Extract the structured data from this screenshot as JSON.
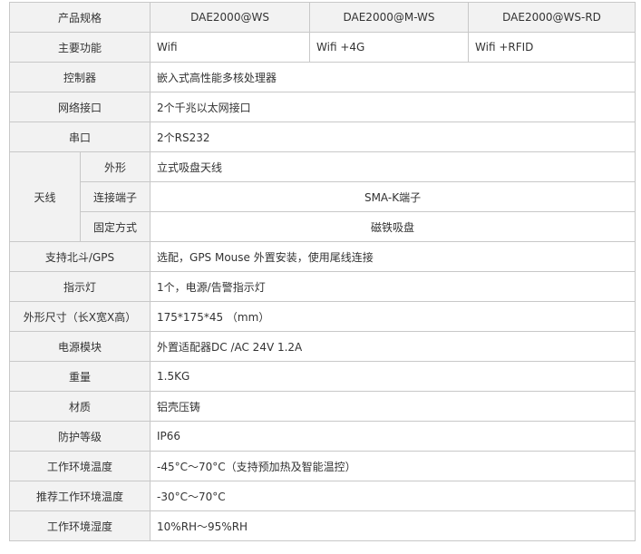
{
  "header": {
    "label": "产品规格",
    "models": [
      "DAE2000@WS",
      "DAE2000@M-WS",
      "DAE2000@WS-RD"
    ]
  },
  "main_function": {
    "label": "主要功能",
    "values": [
      "Wifi",
      "Wifi +4G",
      "Wifi +RFID"
    ]
  },
  "controller": {
    "label": "控制器",
    "value": "嵌入式高性能多核处理器"
  },
  "network": {
    "label": "网络接口",
    "value": "2个千兆以太网接口"
  },
  "serial": {
    "label": "串口",
    "value": "2个RS232"
  },
  "antenna": {
    "label": "天线",
    "shape": {
      "label": "外形",
      "value": "立式吸盘天线"
    },
    "connector": {
      "label": "连接端子",
      "value": "SMA-K端子"
    },
    "mount": {
      "label": "固定方式",
      "value": "磁铁吸盘"
    }
  },
  "beidou_gps": {
    "label": "支持北斗/GPS",
    "value": "选配，GPS Mouse 外置安装，使用尾线连接"
  },
  "indicator": {
    "label": "指示灯",
    "value": "1个，电源/告警指示灯"
  },
  "dimensions": {
    "label": "外形尺寸（长X宽X高）",
    "value": "175*175*45 （mm）"
  },
  "power": {
    "label": "电源模块",
    "value": "外置适配器DC /AC 24V 1.2A"
  },
  "weight": {
    "label": "重量",
    "value": "1.5KG"
  },
  "material": {
    "label": "材质",
    "value": "铝壳压铸"
  },
  "protection": {
    "label": "防护等级",
    "value": "IP66"
  },
  "operating_temp": {
    "label": "工作环境温度",
    "value": "-45°C～70°C（支持预加热及智能温控）"
  },
  "recommended_temp": {
    "label": "推荐工作环境温度",
    "value": "-30°C～70°C"
  },
  "humidity": {
    "label": "工作环境湿度",
    "value": "10%RH～95%RH"
  }
}
